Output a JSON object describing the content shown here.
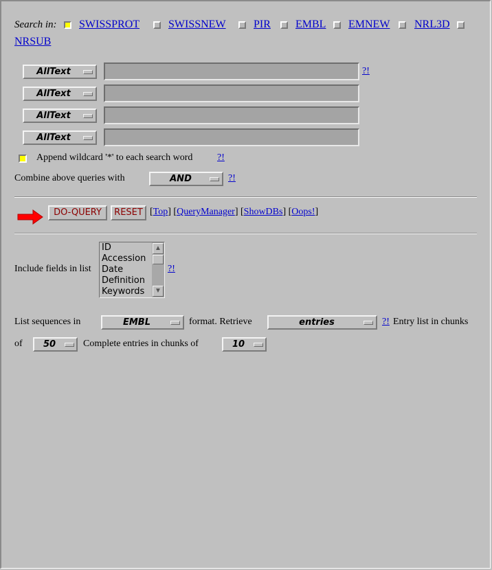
{
  "search_in": {
    "label": "Search in:",
    "databases": [
      {
        "name": "SWISSPROT",
        "checked": true
      },
      {
        "name": "SWISSNEW",
        "checked": false
      },
      {
        "name": "PIR",
        "checked": false
      },
      {
        "name": "EMBL",
        "checked": false
      },
      {
        "name": "EMNEW",
        "checked": false
      },
      {
        "name": "NRL3D",
        "checked": false
      },
      {
        "name": "NRSUB",
        "checked": false
      }
    ]
  },
  "query_rows": [
    {
      "field": "AllText",
      "value": ""
    },
    {
      "field": "AllText",
      "value": ""
    },
    {
      "field": "AllText",
      "value": ""
    },
    {
      "field": "AllText",
      "value": ""
    }
  ],
  "help_link": "?!",
  "wildcard": {
    "label": "Append wildcard '*' to each search word",
    "checked": true
  },
  "combine": {
    "label": "Combine above queries with",
    "value": "AND"
  },
  "actions": {
    "do_query": "DO-QUERY",
    "reset": "RESET",
    "links": [
      "Top",
      "QueryManager",
      "ShowDBs",
      "Oops!"
    ]
  },
  "include_fields": {
    "label": "Include fields in list",
    "options": [
      "ID",
      "Accession",
      "Date",
      "Definition",
      "Keywords"
    ]
  },
  "list_sequences": {
    "label_before": "List sequences in",
    "format": "EMBL",
    "label_mid": "format. Retrieve",
    "retrieve": "entries",
    "label_after": "Entry list in chunks",
    "of_label": "of",
    "chunk": "50",
    "complete_label": "Complete entries in chunks of",
    "complete_chunk": "10"
  },
  "colors": {
    "background": "#c0c0c0",
    "link": "#0000cc",
    "checked": "#ffff00",
    "button_text": "#8b0000",
    "arrow": "#ff0000"
  }
}
